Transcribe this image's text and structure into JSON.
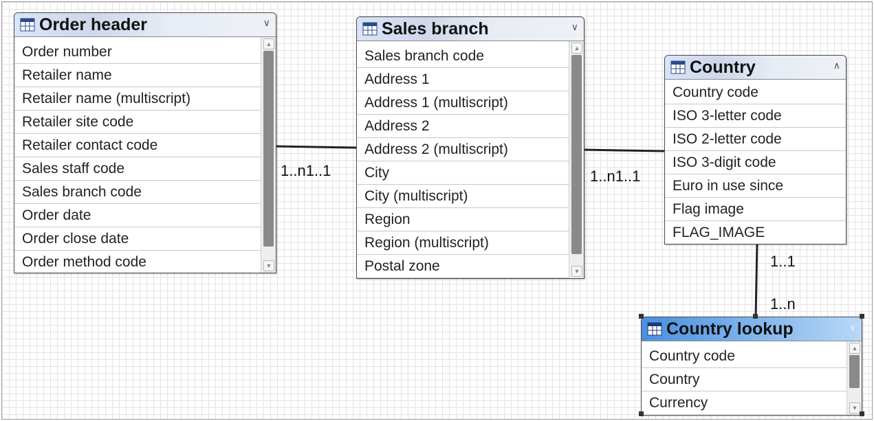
{
  "tables": {
    "order_header": {
      "title": "Order header",
      "columns": [
        "Order number",
        "Retailer name",
        "Retailer name (multiscript)",
        "Retailer site code",
        "Retailer contact code",
        "Sales staff code",
        "Sales branch code",
        "Order date",
        "Order close date",
        "Order method code"
      ]
    },
    "sales_branch": {
      "title": "Sales branch",
      "columns": [
        "Sales branch code",
        "Address 1",
        "Address 1 (multiscript)",
        "Address 2",
        "Address 2 (multiscript)",
        "City",
        "City (multiscript)",
        "Region",
        "Region (multiscript)",
        "Postal zone"
      ]
    },
    "country": {
      "title": "Country",
      "columns": [
        "Country code",
        "ISO 3-letter code",
        "ISO 2-letter code",
        "ISO 3-digit code",
        "Euro in use since",
        "Flag image",
        "FLAG_IMAGE"
      ]
    },
    "country_lookup": {
      "title": "Country lookup",
      "columns": [
        "Country code",
        "Country",
        "Currency"
      ]
    }
  },
  "relationships": {
    "order_sales": "1..n1..1",
    "sales_country": "1..n1..1",
    "country_end": "1..1",
    "lookup_end": "1..n"
  },
  "colors": {
    "header": "#d9e4f8",
    "selected_header": "#4a8ee0",
    "grid": "#e3e3e3"
  },
  "icons": {
    "table": "table-icon",
    "collapse": "chevron-down-icon",
    "expand": "chevron-up-icon"
  }
}
